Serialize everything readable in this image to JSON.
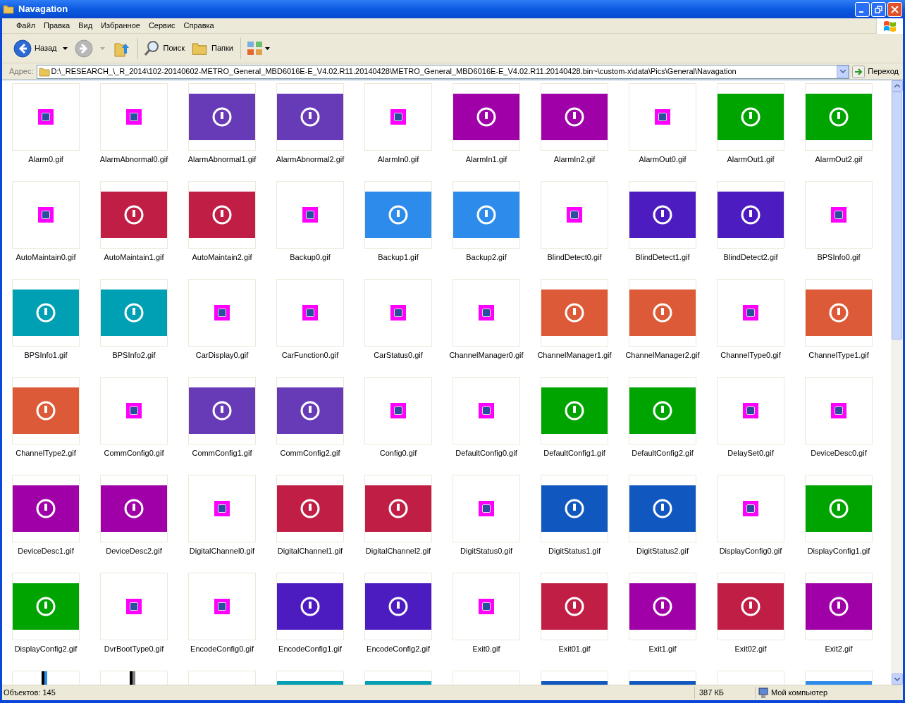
{
  "window": {
    "title": "Navagation"
  },
  "menu": [
    "Файл",
    "Правка",
    "Вид",
    "Избранное",
    "Сервис",
    "Справка"
  ],
  "toolbar": {
    "back": {
      "label": "Назад"
    },
    "forward": {
      "disabled": true
    },
    "search": {
      "label": "Поиск"
    },
    "folders": {
      "label": "Папки"
    }
  },
  "address": {
    "label": "Адрес:",
    "value": "D:\\_RESEARCH_\\_R_2014\\102-20140602-METRO_General_MBD6016E-E_V4.02.R11.20140428\\METRO_General_MBD6016E-E_V4.02.R11.20140428.bin~\\custom-x\\data\\Pics\\General\\Navagation",
    "go": "Переход"
  },
  "files": [
    {
      "name": "Alarm0.gif",
      "kind": "small"
    },
    {
      "name": "AlarmAbnormal0.gif",
      "kind": "small"
    },
    {
      "name": "AlarmAbnormal1.gif",
      "kind": "tile",
      "color": "#673ab7"
    },
    {
      "name": "AlarmAbnormal2.gif",
      "kind": "tile",
      "color": "#673ab7"
    },
    {
      "name": "AlarmIn0.gif",
      "kind": "small"
    },
    {
      "name": "AlarmIn1.gif",
      "kind": "tile",
      "color": "#a000a8"
    },
    {
      "name": "AlarmIn2.gif",
      "kind": "tile",
      "color": "#a000a8"
    },
    {
      "name": "AlarmOut0.gif",
      "kind": "small"
    },
    {
      "name": "AlarmOut1.gif",
      "kind": "tile",
      "color": "#00a400"
    },
    {
      "name": "AlarmOut2.gif",
      "kind": "tile",
      "color": "#00a400"
    },
    {
      "name": "AutoMaintain0.gif",
      "kind": "small"
    },
    {
      "name": "AutoMaintain1.gif",
      "kind": "tile",
      "color": "#c01e45"
    },
    {
      "name": "AutoMaintain2.gif",
      "kind": "tile",
      "color": "#c01e45"
    },
    {
      "name": "Backup0.gif",
      "kind": "small"
    },
    {
      "name": "Backup1.gif",
      "kind": "tile",
      "color": "#2d8ceb"
    },
    {
      "name": "Backup2.gif",
      "kind": "tile",
      "color": "#2d8ceb"
    },
    {
      "name": "BlindDetect0.gif",
      "kind": "small"
    },
    {
      "name": "BlindDetect1.gif",
      "kind": "tile",
      "color": "#4c1cc0"
    },
    {
      "name": "BlindDetect2.gif",
      "kind": "tile",
      "color": "#4c1cc0"
    },
    {
      "name": "BPSInfo0.gif",
      "kind": "small"
    },
    {
      "name": "BPSInfo1.gif",
      "kind": "tile",
      "color": "#00a0b4"
    },
    {
      "name": "BPSInfo2.gif",
      "kind": "tile",
      "color": "#00a0b4"
    },
    {
      "name": "CarDisplay0.gif",
      "kind": "small"
    },
    {
      "name": "CarFunction0.gif",
      "kind": "small"
    },
    {
      "name": "CarStatus0.gif",
      "kind": "small"
    },
    {
      "name": "ChannelManager0.gif",
      "kind": "small"
    },
    {
      "name": "ChannelManager1.gif",
      "kind": "tile",
      "color": "#dc5a37"
    },
    {
      "name": "ChannelManager2.gif",
      "kind": "tile",
      "color": "#dc5a37"
    },
    {
      "name": "ChannelType0.gif",
      "kind": "small"
    },
    {
      "name": "ChannelType1.gif",
      "kind": "tile",
      "color": "#dc5a37"
    },
    {
      "name": "ChannelType2.gif",
      "kind": "tile",
      "color": "#dc5a37"
    },
    {
      "name": "CommConfig0.gif",
      "kind": "small"
    },
    {
      "name": "CommConfig1.gif",
      "kind": "tile",
      "color": "#673ab7"
    },
    {
      "name": "CommConfig2.gif",
      "kind": "tile",
      "color": "#673ab7"
    },
    {
      "name": "Config0.gif",
      "kind": "small"
    },
    {
      "name": "DefaultConfig0.gif",
      "kind": "small"
    },
    {
      "name": "DefaultConfig1.gif",
      "kind": "tile",
      "color": "#00a400"
    },
    {
      "name": "DefaultConfig2.gif",
      "kind": "tile",
      "color": "#00a400"
    },
    {
      "name": "DelaySet0.gif",
      "kind": "small"
    },
    {
      "name": "DeviceDesc0.gif",
      "kind": "small"
    },
    {
      "name": "DeviceDesc1.gif",
      "kind": "tile",
      "color": "#a000a8"
    },
    {
      "name": "DeviceDesc2.gif",
      "kind": "tile",
      "color": "#a000a8"
    },
    {
      "name": "DigitalChannel0.gif",
      "kind": "small"
    },
    {
      "name": "DigitalChannel1.gif",
      "kind": "tile",
      "color": "#c01e45"
    },
    {
      "name": "DigitalChannel2.gif",
      "kind": "tile",
      "color": "#c01e45"
    },
    {
      "name": "DigitStatus0.gif",
      "kind": "small"
    },
    {
      "name": "DigitStatus1.gif",
      "kind": "tile",
      "color": "#1058c0"
    },
    {
      "name": "DigitStatus2.gif",
      "kind": "tile",
      "color": "#1058c0"
    },
    {
      "name": "DisplayConfig0.gif",
      "kind": "small"
    },
    {
      "name": "DisplayConfig1.gif",
      "kind": "tile",
      "color": "#00a400"
    },
    {
      "name": "DisplayConfig2.gif",
      "kind": "tile",
      "color": "#00a400"
    },
    {
      "name": "DvrBootType0.gif",
      "kind": "small"
    },
    {
      "name": "EncodeConfig0.gif",
      "kind": "small"
    },
    {
      "name": "EncodeConfig1.gif",
      "kind": "tile",
      "color": "#4c1cc0"
    },
    {
      "name": "EncodeConfig2.gif",
      "kind": "tile",
      "color": "#4c1cc0"
    },
    {
      "name": "Exit0.gif",
      "kind": "small"
    },
    {
      "name": "Exit01.gif",
      "kind": "tile",
      "color": "#c01e45"
    },
    {
      "name": "Exit1.gif",
      "kind": "tile",
      "color": "#a000a8"
    },
    {
      "name": "Exit02.gif",
      "kind": "tile",
      "color": "#c01e45"
    },
    {
      "name": "Exit2.gif",
      "kind": "tile",
      "color": "#a000a8"
    }
  ],
  "partial_row": [
    {
      "kind": "strip",
      "color": "#2d8ceb"
    },
    {
      "kind": "strip",
      "color": "#808080"
    },
    {
      "kind": "blank"
    },
    {
      "kind": "tile",
      "color": "#00a0b4"
    },
    {
      "kind": "tile",
      "color": "#00a0b4"
    },
    {
      "kind": "blank"
    },
    {
      "kind": "tile",
      "color": "#1058c0"
    },
    {
      "kind": "tile",
      "color": "#1058c0"
    },
    {
      "kind": "blank"
    },
    {
      "kind": "tile",
      "color": "#2d8ceb"
    }
  ],
  "status_bar": {
    "count": "Объектов: 145",
    "size": "387 КБ",
    "zone": "Мой компьютер"
  }
}
